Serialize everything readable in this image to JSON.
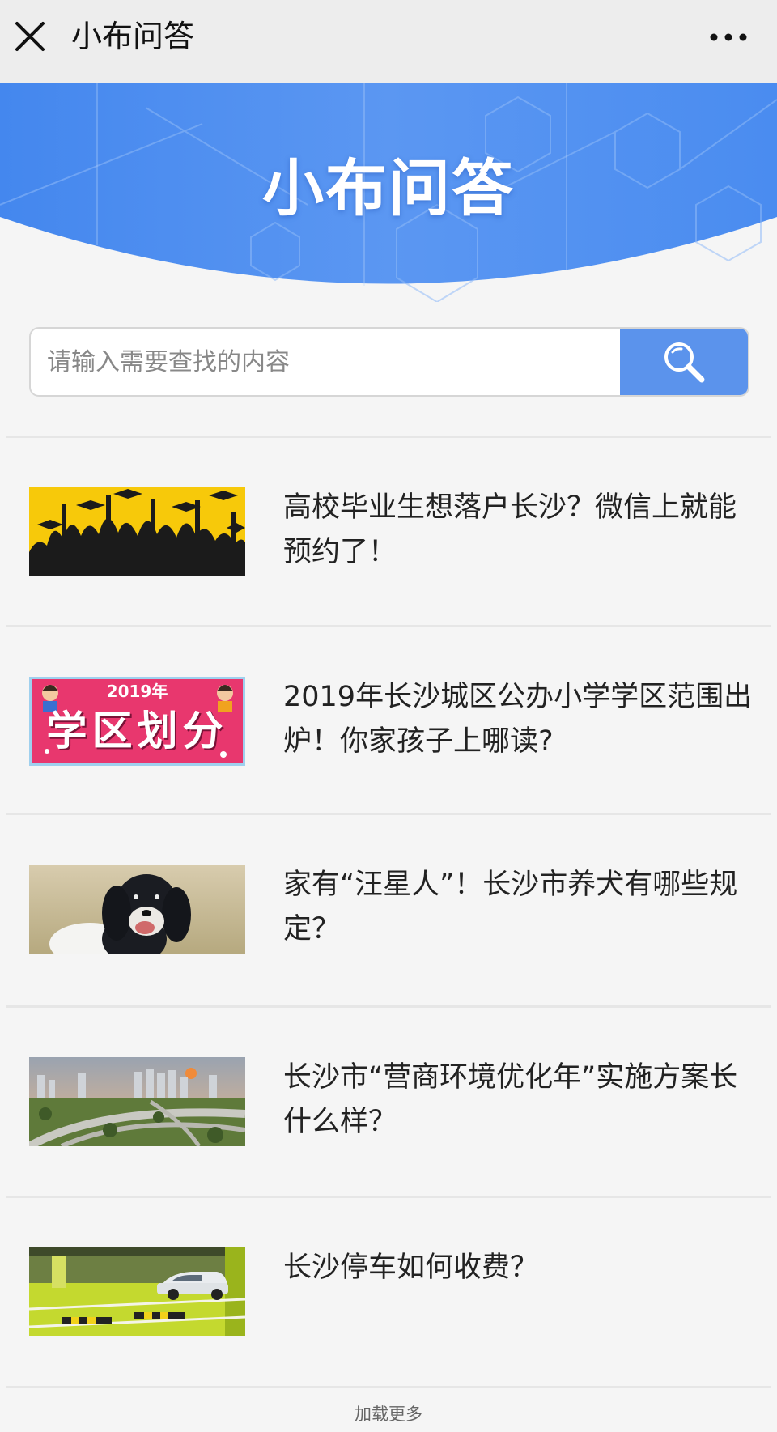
{
  "navbar": {
    "title": "小布问答",
    "close_icon": "close-icon",
    "more_icon": "more-dots-icon"
  },
  "banner": {
    "title": "小布问答",
    "color": "#4f8ff0"
  },
  "search": {
    "placeholder": "请输入需要查找的内容",
    "value": "",
    "button_icon": "search-icon",
    "button_color": "#5b93ec"
  },
  "articles": [
    {
      "title": "高校毕业生想落户长沙？微信上就能预约了！",
      "thumbnail": "graduates-silhouette"
    },
    {
      "title": "2019年长沙城区公办小学学区范围出炉！你家孩子上哪读?",
      "thumbnail": "school-district-banner",
      "thumb_year": "2019年",
      "thumb_text": "学区划分"
    },
    {
      "title": "家有“汪星人”！长沙市养犬有哪些规定？",
      "thumbnail": "dog-photo"
    },
    {
      "title": "长沙市“营商环境优化年”实施方案长什么样？",
      "thumbnail": "city-skyline"
    },
    {
      "title": "长沙停车如何收费？",
      "thumbnail": "parking-garage"
    }
  ],
  "load_more": "加载更多"
}
